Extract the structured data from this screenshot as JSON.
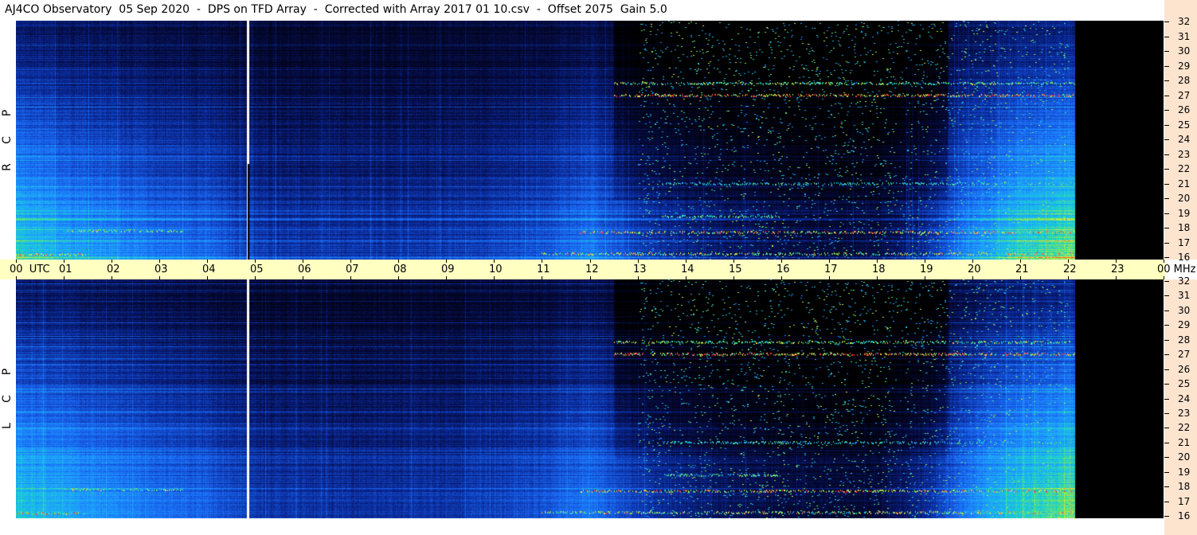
{
  "title": "AJ4CO Observatory  05 Sep 2020  -  DPS on TFD Array  -  Corrected with Array 2017 01 10.csv  -  Offset 2075  Gain 5.0",
  "panels": [
    {
      "id": "rcp",
      "label": [
        "R",
        "C",
        "P"
      ]
    },
    {
      "id": "lcp",
      "label": [
        "L",
        "C",
        "P"
      ]
    }
  ],
  "colors": {
    "background": "#000000",
    "low": "#0a2a8a",
    "mid": "#1f6bff",
    "high": "#19d9d0",
    "peak": "#f0f040",
    "hot": "#ff3a3a",
    "frequency_axis_bg": "#fde4cf",
    "time_axis_bg": "#ffffc2",
    "white_marker": "#ffffff"
  },
  "chart_data": {
    "type": "heatmap",
    "title": "AJ4CO Observatory  05 Sep 2020  -  DPS on TFD Array  -  Corrected with Array 2017 01 10.csv  -  Offset 2075  Gain 5.0",
    "x_axis": {
      "unit": "UTC",
      "ticks": [
        "00",
        "01",
        "02",
        "03",
        "04",
        "05",
        "06",
        "07",
        "08",
        "09",
        "10",
        "11",
        "12",
        "13",
        "14",
        "15",
        "16",
        "17",
        "18",
        "19",
        "20",
        "21",
        "22",
        "23",
        "00"
      ],
      "range": [
        0,
        24
      ]
    },
    "y_axis": {
      "unit": "MHz",
      "ticks": [
        "16",
        "17",
        "18",
        "19",
        "20",
        "21",
        "22",
        "23",
        "24",
        "25",
        "26",
        "27",
        "28",
        "29",
        "30",
        "31",
        "32"
      ],
      "range": [
        16,
        32
      ]
    },
    "data_end_utc": 22.15,
    "marker_utc": 4.85,
    "intensity_profile_utc": [
      [
        0,
        0.62
      ],
      [
        1,
        0.55
      ],
      [
        2,
        0.5
      ],
      [
        3,
        0.44
      ],
      [
        4,
        0.42
      ],
      [
        5,
        0.32
      ],
      [
        6,
        0.3
      ],
      [
        7,
        0.3
      ],
      [
        8,
        0.3
      ],
      [
        9,
        0.31
      ],
      [
        10,
        0.34
      ],
      [
        11,
        0.38
      ],
      [
        12,
        0.46
      ],
      [
        13,
        0.33
      ],
      [
        14,
        0.25
      ],
      [
        15,
        0.2
      ],
      [
        16,
        0.16
      ],
      [
        17,
        0.14
      ],
      [
        18,
        0.15
      ],
      [
        19,
        0.28
      ],
      [
        20,
        0.5
      ],
      [
        21,
        0.64
      ],
      [
        22,
        0.7
      ]
    ],
    "bright_bands_mhz": [
      {
        "freq": 27,
        "start": 12.5,
        "end": 22.15,
        "level": 0.95
      },
      {
        "freq": 27.8,
        "start": 12.5,
        "end": 22.15,
        "level": 0.8
      },
      {
        "freq": 17.8,
        "start": 11.8,
        "end": 22.15,
        "level": 0.9
      },
      {
        "freq": 16.4,
        "start": 11.0,
        "end": 22.15,
        "level": 0.85
      },
      {
        "freq": 21.1,
        "start": 13.5,
        "end": 22.15,
        "level": 0.7
      },
      {
        "freq": 18.9,
        "start": 13.5,
        "end": 16.0,
        "level": 0.75
      },
      {
        "freq": 17.9,
        "start": 1.0,
        "end": 3.5,
        "level": 0.8
      },
      {
        "freq": 16.3,
        "start": 0,
        "end": 1.5,
        "level": 0.9
      }
    ]
  }
}
